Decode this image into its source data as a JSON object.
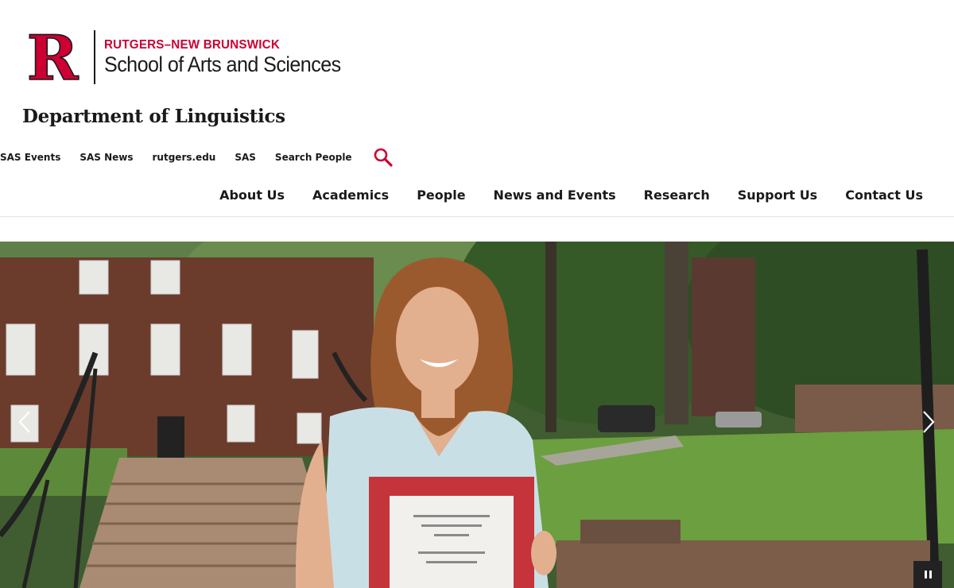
{
  "brand": {
    "logo_letter": "R",
    "sub_title": "RUTGERS–NEW BRUNSWICK",
    "main_title": "School of Arts and Sciences",
    "accent_color": "#cc0033"
  },
  "department": {
    "title": "Department of Linguistics"
  },
  "utility_nav": [
    {
      "label": "SAS Events"
    },
    {
      "label": "SAS News"
    },
    {
      "label": "rutgers.edu"
    },
    {
      "label": "SAS"
    },
    {
      "label": "Search People"
    }
  ],
  "search": {
    "icon": "search-icon"
  },
  "main_nav": [
    {
      "label": "About Us"
    },
    {
      "label": "Academics"
    },
    {
      "label": "People"
    },
    {
      "label": "News and Events"
    },
    {
      "label": "Research"
    },
    {
      "label": "Support Us"
    },
    {
      "label": "Contact Us"
    }
  ],
  "hero": {
    "prev_icon": "chevron-left-icon",
    "next_icon": "chevron-right-icon",
    "pause_icon": "pause-icon"
  }
}
